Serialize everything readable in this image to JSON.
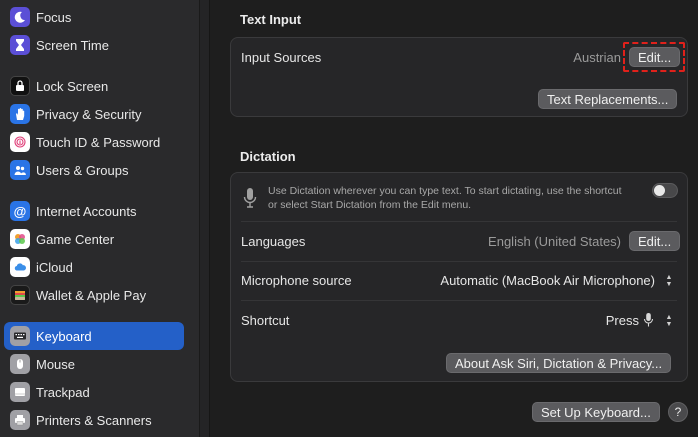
{
  "sidebar": {
    "items": [
      {
        "label": "Focus",
        "icon": "moon-icon",
        "color": "#5b4fd6"
      },
      {
        "label": "Screen Time",
        "icon": "hourglass-icon",
        "color": "#5b4fd6"
      },
      {
        "label": "Lock Screen",
        "icon": "lock-screen-icon",
        "color": "#111111"
      },
      {
        "label": "Privacy & Security",
        "icon": "hand-icon",
        "color": "#2a74e6"
      },
      {
        "label": "Touch ID & Password",
        "icon": "fingerprint-icon",
        "color": "#ffffff"
      },
      {
        "label": "Users & Groups",
        "icon": "users-icon",
        "color": "#2a74e6"
      },
      {
        "label": "Internet Accounts",
        "icon": "at-icon",
        "color": "#2a74e6"
      },
      {
        "label": "Game Center",
        "icon": "game-center-icon",
        "color": "#ffffff"
      },
      {
        "label": "iCloud",
        "icon": "cloud-icon",
        "color": "#ffffff"
      },
      {
        "label": "Wallet & Apple Pay",
        "icon": "wallet-icon",
        "color": "#1a1a1a"
      },
      {
        "label": "Keyboard",
        "icon": "keyboard-icon",
        "color": "#8e8e93",
        "selected": true
      },
      {
        "label": "Mouse",
        "icon": "mouse-icon",
        "color": "#8e8e93"
      },
      {
        "label": "Trackpad",
        "icon": "trackpad-icon",
        "color": "#8e8e93"
      },
      {
        "label": "Printers & Scanners",
        "icon": "printer-icon",
        "color": "#8e8e93"
      }
    ]
  },
  "text_input": {
    "title": "Text Input",
    "input_sources_label": "Input Sources",
    "input_sources_value": "Austrian",
    "edit_label": "Edit...",
    "text_replacements_label": "Text Replacements..."
  },
  "dictation": {
    "title": "Dictation",
    "description_line1": "Use Dictation wherever you can type text. To start dictating, use the shortcut",
    "description_line2": "or select Start Dictation from the Edit menu.",
    "enabled": false,
    "languages_label": "Languages",
    "languages_value": "English (United States)",
    "languages_edit_label": "Edit...",
    "mic_label": "Microphone source",
    "mic_value": "Automatic (MacBook Air Microphone)",
    "shortcut_label": "Shortcut",
    "shortcut_value": "Press",
    "about_label": "About Ask Siri, Dictation & Privacy..."
  },
  "footer": {
    "setup_label": "Set Up Keyboard...",
    "help_label": "?"
  }
}
